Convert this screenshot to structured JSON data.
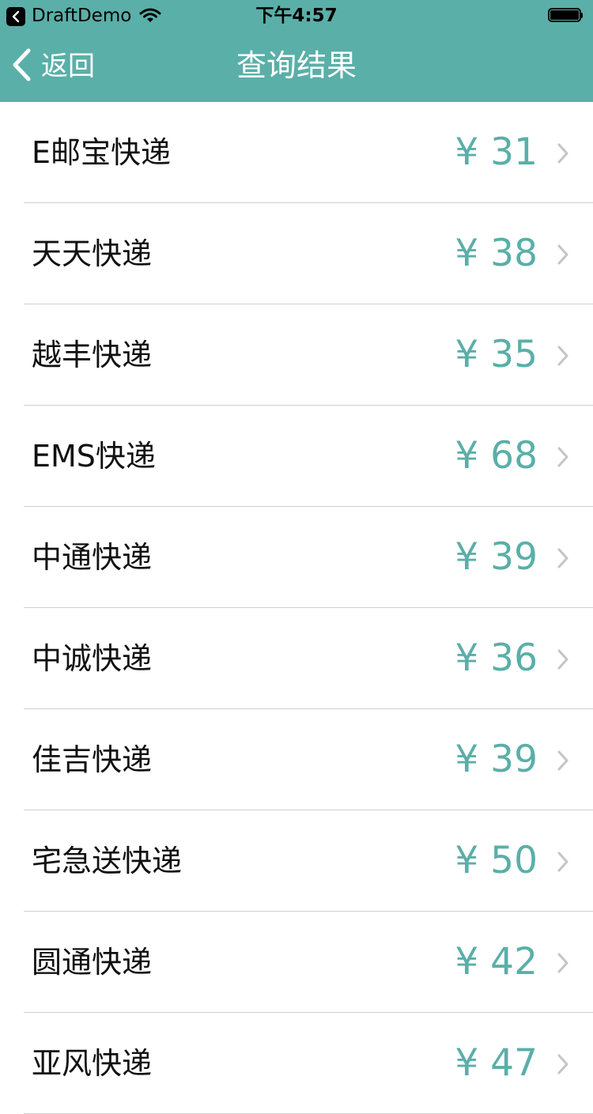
{
  "status_bar": {
    "app_name": "DraftDemo",
    "time": "下午4:57"
  },
  "nav": {
    "back_label": "返回",
    "title": "查询结果"
  },
  "colors": {
    "accent": "#5aafa8"
  },
  "results": [
    {
      "name": "E邮宝快递",
      "price": "¥ 31"
    },
    {
      "name": "天天快递",
      "price": "¥ 38"
    },
    {
      "name": "越丰快递",
      "price": "¥ 35"
    },
    {
      "name": "EMS快递",
      "price": "¥ 68"
    },
    {
      "name": "中通快递",
      "price": "¥ 39"
    },
    {
      "name": "中诚快递",
      "price": "¥ 36"
    },
    {
      "name": "佳吉快递",
      "price": "¥ 39"
    },
    {
      "name": "宅急送快递",
      "price": "¥ 50"
    },
    {
      "name": "圆通快递",
      "price": "¥ 42"
    },
    {
      "name": "亚风快递",
      "price": "¥ 47"
    }
  ]
}
